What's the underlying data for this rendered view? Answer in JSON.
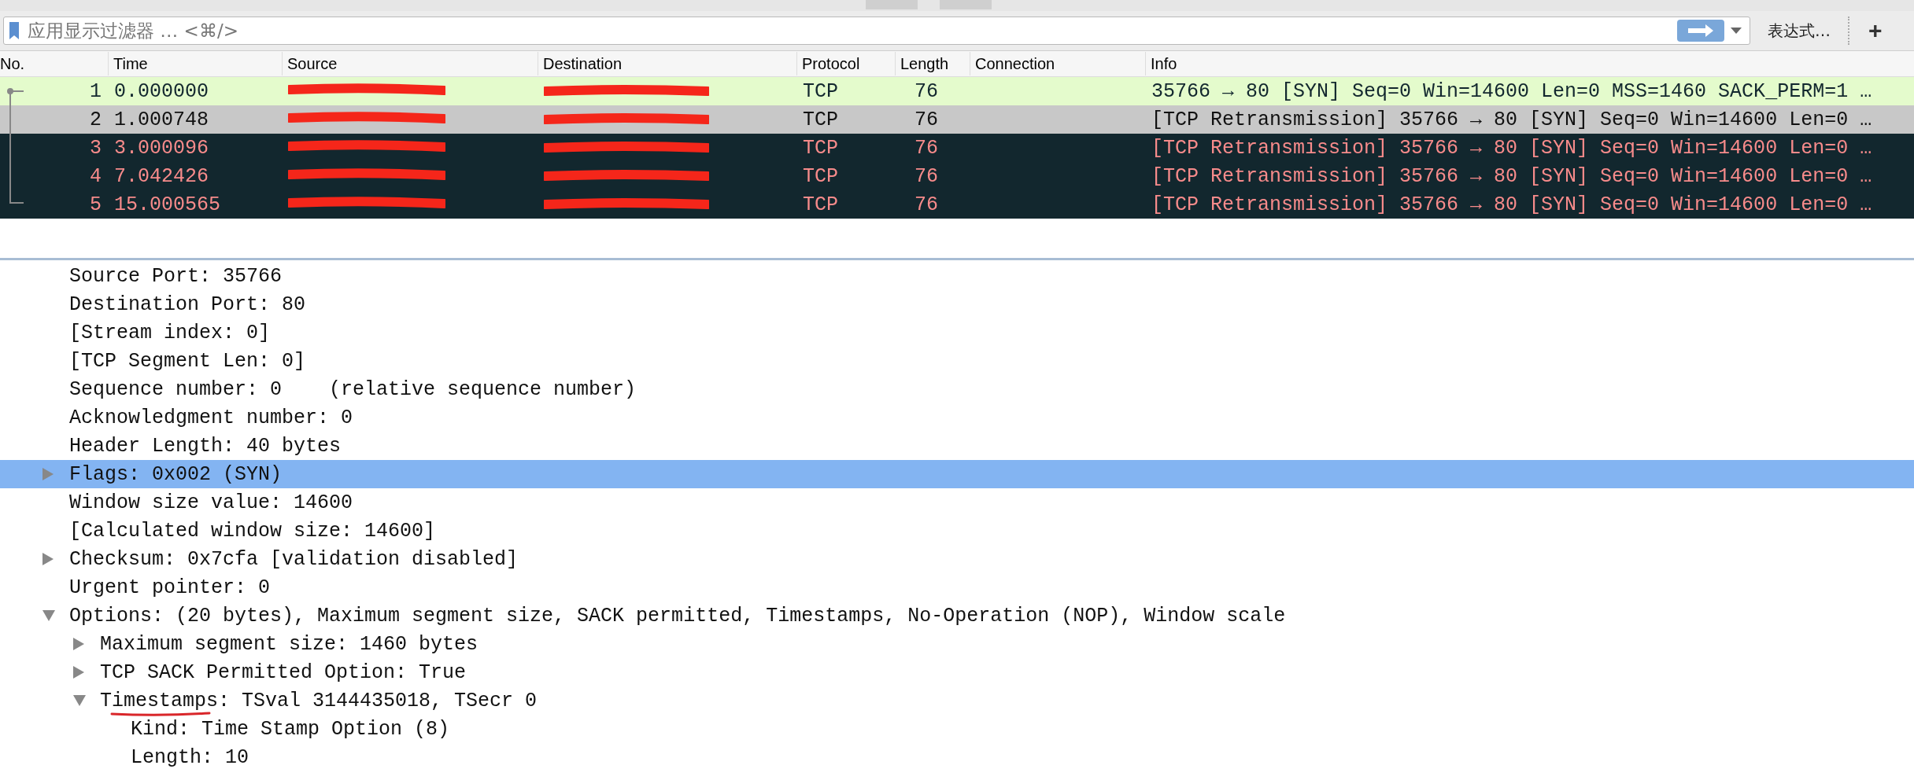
{
  "filter_bar": {
    "placeholder": "应用显示过滤器 … <⌘/>",
    "expression_button": "表达式…",
    "add_button": "+"
  },
  "packet_list": {
    "columns": [
      "No.",
      "Time",
      "Source",
      "Destination",
      "Protocol",
      "Length",
      "Connection",
      "Info"
    ],
    "rows": [
      {
        "no": "1",
        "time": "0.000000",
        "protocol": "TCP",
        "length": "76",
        "info": "35766 → 80 [SYN] Seq=0 Win=14600 Len=0 MSS=1460 SACK_PERM=1 …",
        "kind": "tcp",
        "selected": false
      },
      {
        "no": "2",
        "time": "1.000748",
        "protocol": "TCP",
        "length": "76",
        "info": "[TCP Retransmission] 35766 → 80 [SYN] Seq=0 Win=14600 Len=0 …",
        "kind": "bad-tcp",
        "selected": true
      },
      {
        "no": "3",
        "time": "3.000096",
        "protocol": "TCP",
        "length": "76",
        "info": "[TCP Retransmission] 35766 → 80 [SYN] Seq=0 Win=14600 Len=0 …",
        "kind": "bad-tcp",
        "selected": false
      },
      {
        "no": "4",
        "time": "7.042426",
        "protocol": "TCP",
        "length": "76",
        "info": "[TCP Retransmission] 35766 → 80 [SYN] Seq=0 Win=14600 Len=0 …",
        "kind": "bad-tcp",
        "selected": false
      },
      {
        "no": "5",
        "time": "15.000565",
        "protocol": "TCP",
        "length": "76",
        "info": "[TCP Retransmission] 35766 → 80 [SYN] Seq=0 Win=14600 Len=0 …",
        "kind": "bad-tcp",
        "selected": false
      }
    ]
  },
  "details": [
    {
      "text": "Source Port: 35766",
      "selected": false
    },
    {
      "text": "Destination Port: 80",
      "selected": false
    },
    {
      "text": "[Stream index: 0]",
      "selected": false
    },
    {
      "text": "[TCP Segment Len: 0]",
      "selected": false
    },
    {
      "text": "Sequence number: 0    (relative sequence number)",
      "selected": false
    },
    {
      "text": "Acknowledgment number: 0",
      "selected": false
    },
    {
      "text": "Header Length: 40 bytes",
      "selected": false
    },
    {
      "text": "Flags: 0x002 (SYN)",
      "selected": true,
      "expanded": false
    },
    {
      "text": "Window size value: 14600",
      "selected": false
    },
    {
      "text": "[Calculated window size: 14600]",
      "selected": false
    },
    {
      "text": "Checksum: 0x7cfa [validation disabled]",
      "selected": false,
      "expanded": false
    },
    {
      "text": "Urgent pointer: 0",
      "selected": false
    },
    {
      "text": "Options: (20 bytes), Maximum segment size, SACK permitted, Timestamps, No-Operation (NOP), Window scale",
      "selected": false,
      "expanded": true,
      "children": [
        {
          "text": "Maximum segment size: 1460 bytes",
          "selected": false,
          "expanded": false
        },
        {
          "text": "TCP SACK Permitted Option: True",
          "selected": false,
          "expanded": false
        },
        {
          "text": "Timestamps: TSval 3144435018, TSecr 0",
          "selected": false,
          "expanded": true,
          "underlined": true,
          "children": [
            {
              "text": "Kind: Time Stamp Option (8)",
              "selected": false
            },
            {
              "text": "Length: 10",
              "selected": false
            }
          ]
        }
      ]
    }
  ]
}
